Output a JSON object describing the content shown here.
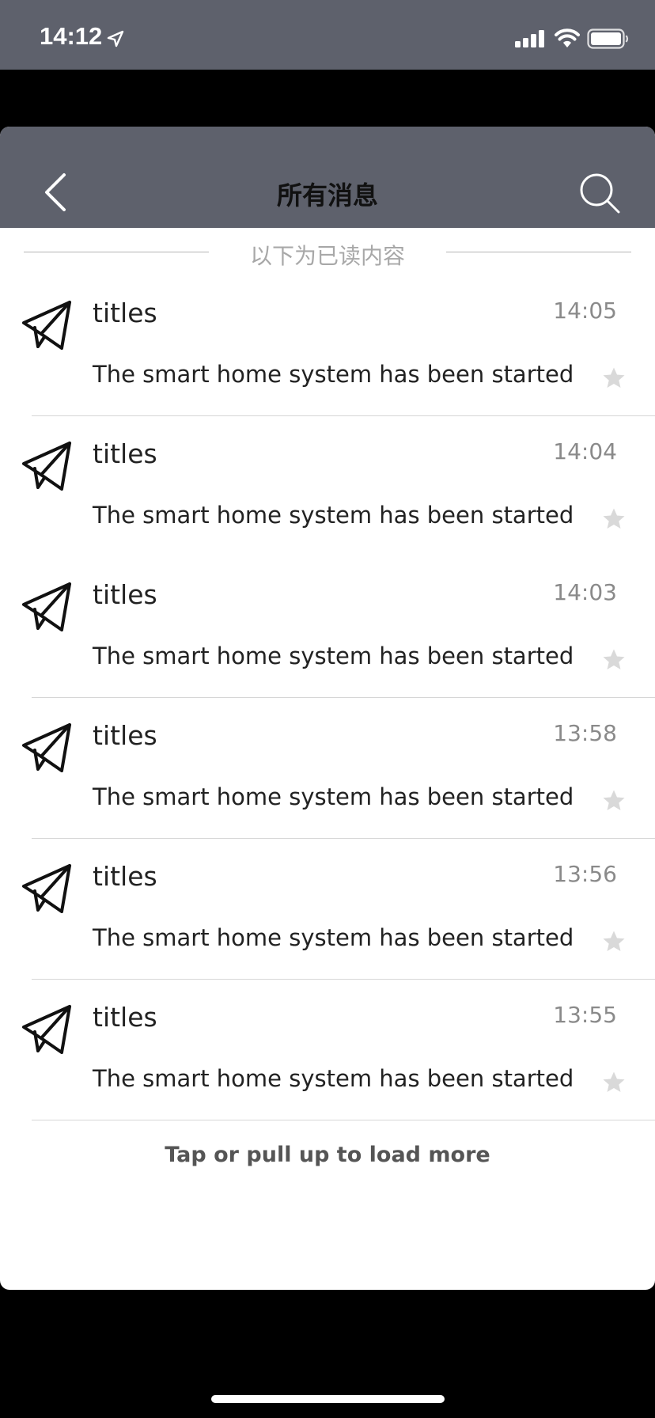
{
  "status_bar": {
    "time": "14:12"
  },
  "nav": {
    "title": "所有消息"
  },
  "divider": {
    "text": "以下为已读内容"
  },
  "messages": [
    {
      "title": "titles",
      "time": "14:05",
      "body": "The smart home system has been started",
      "separator": true
    },
    {
      "title": "titles",
      "time": "14:04",
      "body": "The smart home system has been started",
      "separator": false
    },
    {
      "title": "titles",
      "time": "14:03",
      "body": "The smart home system has been started",
      "separator": true
    },
    {
      "title": "titles",
      "time": "13:58",
      "body": "The smart home system has been started",
      "separator": true
    },
    {
      "title": "titles",
      "time": "13:56",
      "body": "The smart home system has been started",
      "separator": true
    },
    {
      "title": "titles",
      "time": "13:55",
      "body": "The smart home system has been started",
      "separator": true
    }
  ],
  "footer": {
    "load_more": "Tap or pull up to load more"
  },
  "colors": {
    "bar": "#5e616c",
    "star": "#d9d9d9"
  },
  "icons": {
    "back": "chevron-left-icon",
    "search": "search-icon",
    "message": "paper-plane-icon",
    "favorite": "star-icon"
  }
}
